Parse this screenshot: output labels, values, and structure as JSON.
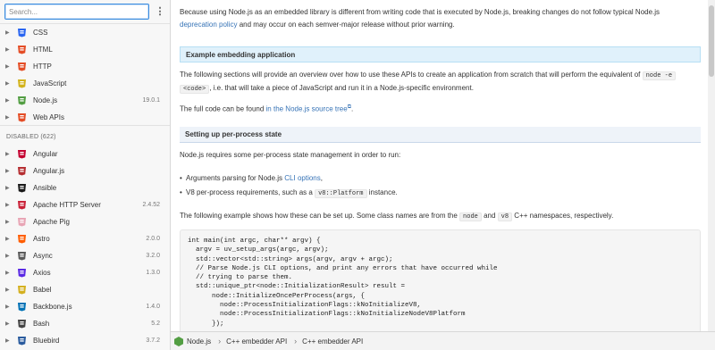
{
  "search": {
    "placeholder": "Search...",
    "value": ""
  },
  "menu_icon": "vertical-ellipsis-icon",
  "enabled_docs": [
    {
      "label": "CSS",
      "version": "",
      "icon": "css-icon",
      "color": "#2965f1"
    },
    {
      "label": "HTML",
      "version": "",
      "icon": "html-icon",
      "color": "#e44d26"
    },
    {
      "label": "HTTP",
      "version": "",
      "icon": "http-icon",
      "color": "#e44d26"
    },
    {
      "label": "JavaScript",
      "version": "",
      "icon": "javascript-icon",
      "color": "#d2b21a"
    },
    {
      "label": "Node.js",
      "version": "19.0.1",
      "icon": "nodejs-icon",
      "color": "#539e43"
    },
    {
      "label": "Web APIs",
      "version": "",
      "icon": "web-apis-icon",
      "color": "#e44d26"
    }
  ],
  "disabled_header": "DISABLED (622)",
  "disabled_docs": [
    {
      "label": "Angular",
      "version": "",
      "icon": "angular-icon",
      "color": "#c3002f"
    },
    {
      "label": "Angular.js",
      "version": "",
      "icon": "angularjs-icon",
      "color": "#b52e31"
    },
    {
      "label": "Ansible",
      "version": "",
      "icon": "ansible-icon",
      "color": "#1a1a1a"
    },
    {
      "label": "Apache HTTP Server",
      "version": "2.4.52",
      "icon": "apache-feather-icon",
      "color": "#c92037"
    },
    {
      "label": "Apache Pig",
      "version": "",
      "icon": "apache-pig-icon",
      "color": "#e8a5b5"
    },
    {
      "label": "Astro",
      "version": "2.0.0",
      "icon": "astro-icon",
      "color": "#ff5d01"
    },
    {
      "label": "Async",
      "version": "3.2.0",
      "icon": "async-icon",
      "color": "#5a5a5a"
    },
    {
      "label": "Axios",
      "version": "1.3.0",
      "icon": "axios-icon",
      "color": "#5a29e4"
    },
    {
      "label": "Babel",
      "version": "",
      "icon": "babel-icon",
      "color": "#d4b01f"
    },
    {
      "label": "Backbone.js",
      "version": "1.4.0",
      "icon": "backbone-icon",
      "color": "#0071b5"
    },
    {
      "label": "Bash",
      "version": "5.2",
      "icon": "bash-icon",
      "color": "#444444"
    },
    {
      "label": "Bluebird",
      "version": "3.7.2",
      "icon": "bluebird-icon",
      "color": "#2a5b9e"
    }
  ],
  "content": {
    "intro_text": "Because using Node.js as an embedded library is different from writing code that is executed by Node.js, breaking changes do not follow typical Node.js",
    "intro_link": "deprecation policy",
    "intro_tail": " and may occur on each semver-major release without prior warning.",
    "section1_title": "Example embedding application",
    "para1_a": "The following sections will provide an overview over how to use these APIs to create an application from scratch that will perform the equivalent of",
    "para1_code1": "node -e",
    "para1_code2": "<code>",
    "para1_b": ", i.e. that will take a piece of JavaScript and run it in a Node.js-specific environment.",
    "para2_a": "The full code can be found ",
    "para2_link": "in the Node.js source tree",
    "para2_b": ".",
    "section2_title": "Setting up per-process state",
    "para3": "Node.js requires some per-process state management in order to run:",
    "bullet1_a": "Arguments parsing for Node.js ",
    "bullet1_link": "CLI options",
    "bullet1_b": ",",
    "bullet2_a": "V8 per-process requirements, such as a ",
    "bullet2_code": "v8::Platform",
    "bullet2_b": " instance.",
    "para4_a": "The following example shows how these can be set up. Some class names are from the ",
    "para4_code1": "node",
    "para4_mid": " and ",
    "para4_code2": "v8",
    "para4_b": " C++ namespaces, respectively.",
    "code_lines": [
      "int main(int argc, char** argv) {",
      "  argv = uv_setup_args(argc, argv);",
      "  std::vector<std::string> args(argv, argv + argc);",
      "  // Parse Node.js CLI options, and print any errors that have occurred while",
      "  // trying to parse them.",
      "  std::unique_ptr<node::InitializationResult> result =",
      "      node::InitializeOncePerProcess(args, {",
      "        node::ProcessInitializationFlags::kNoInitializeV8,",
      "        node::ProcessInitializationFlags::kNoInitializeNodeV8Platform",
      "      });"
    ]
  },
  "breadcrumb": [
    {
      "label": "Node.js",
      "icon": "nodejs-icon"
    },
    {
      "label": "C++ embedder API"
    },
    {
      "label": "C++ embedder API"
    }
  ],
  "colors": {
    "accent": "#3673b6",
    "search_border": "#3b8de0",
    "section_bg": "#eef3f9"
  }
}
